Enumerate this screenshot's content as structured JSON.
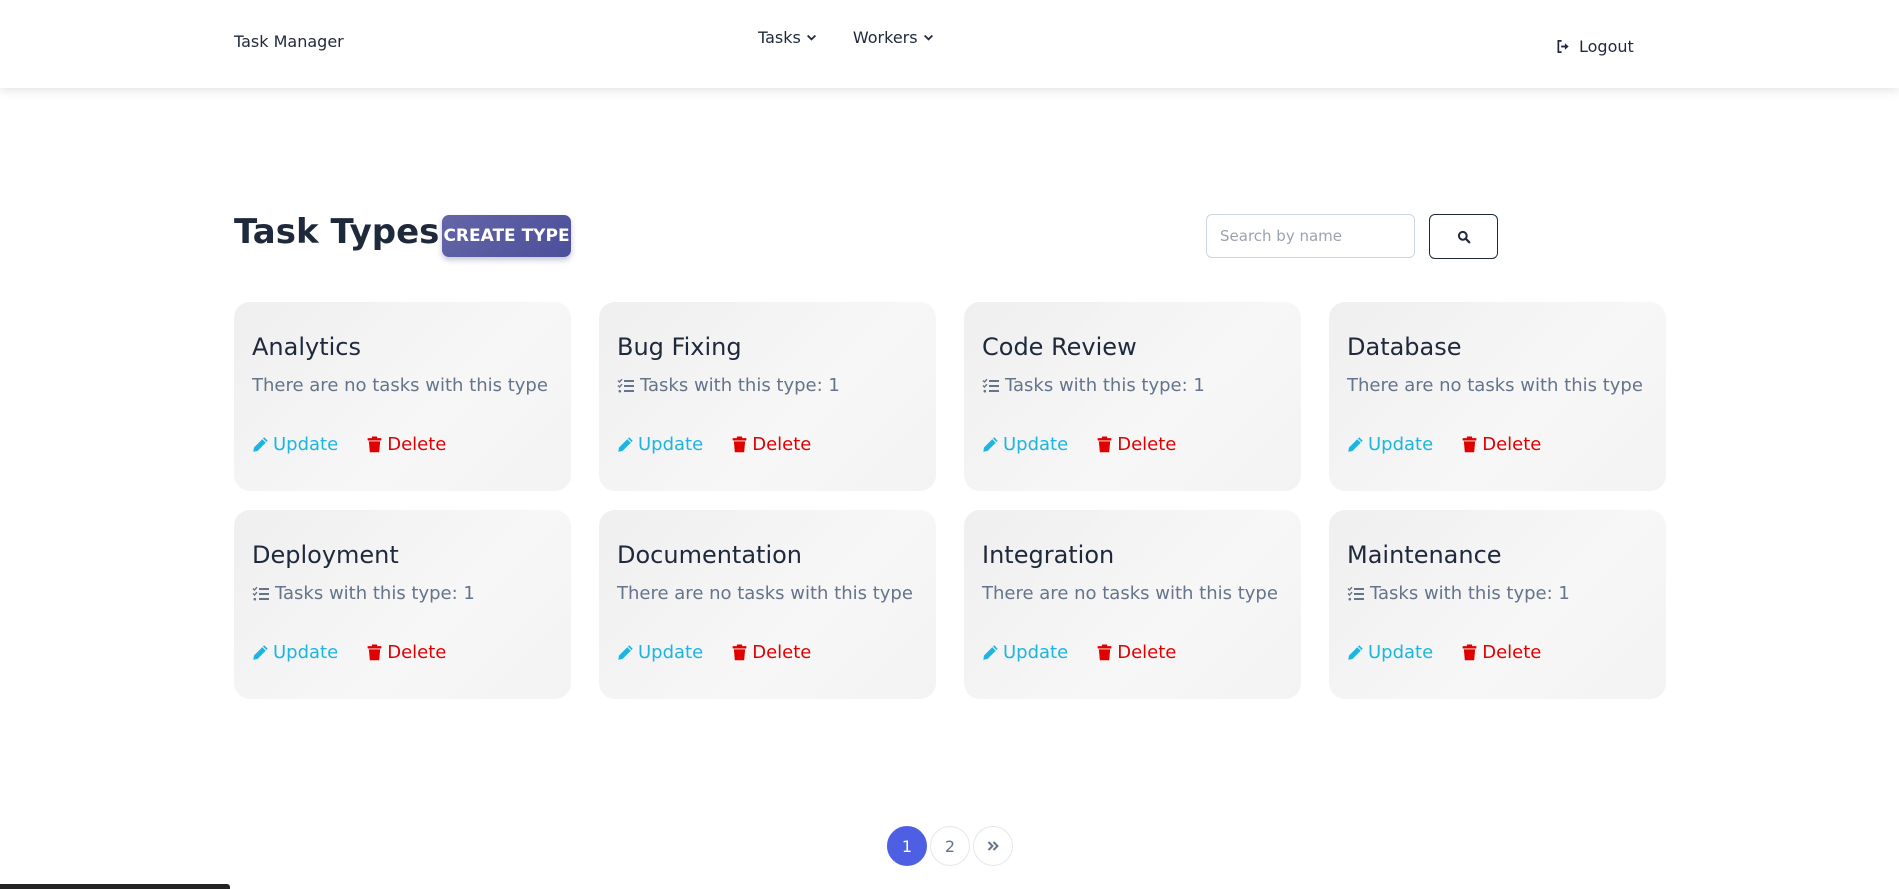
{
  "nav": {
    "brand": "Task Manager",
    "menu": [
      {
        "label": "Tasks"
      },
      {
        "label": "Workers"
      }
    ],
    "logout_label": "Logout"
  },
  "header": {
    "title": "Task Types:",
    "create_button": "CREATE TYPE",
    "search_placeholder": "Search by name"
  },
  "cards": [
    {
      "title": "Analytics",
      "info": "There are no tasks with this type",
      "has_tasks": false
    },
    {
      "title": "Bug Fixing",
      "info": "Tasks with this type: 1",
      "has_tasks": true
    },
    {
      "title": "Code Review",
      "info": "Tasks with this type: 1",
      "has_tasks": true
    },
    {
      "title": "Database",
      "info": "There are no tasks with this type",
      "has_tasks": false
    },
    {
      "title": "Deployment",
      "info": "Tasks with this type: 1",
      "has_tasks": true
    },
    {
      "title": "Documentation",
      "info": "There are no tasks with this type",
      "has_tasks": false
    },
    {
      "title": "Integration",
      "info": "There are no tasks with this type",
      "has_tasks": false
    },
    {
      "title": "Maintenance",
      "info": "Tasks with this type: 1",
      "has_tasks": true
    }
  ],
  "card_actions": {
    "update_label": "Update",
    "delete_label": "Delete"
  },
  "pagination": {
    "pages": [
      "1",
      "2"
    ],
    "current": "1"
  },
  "colors": {
    "update": "#1cb5e0",
    "delete": "#e00000",
    "accent": "#4f5fe3",
    "create_button": "#5a5d9f"
  },
  "icons": {
    "nav_dropdown": "chevron-down-icon",
    "logout": "logout-icon",
    "search": "search-icon",
    "task_list": "task-list-icon",
    "update": "pencil-icon",
    "delete": "trash-icon",
    "next": "double-chevron-right-icon"
  }
}
